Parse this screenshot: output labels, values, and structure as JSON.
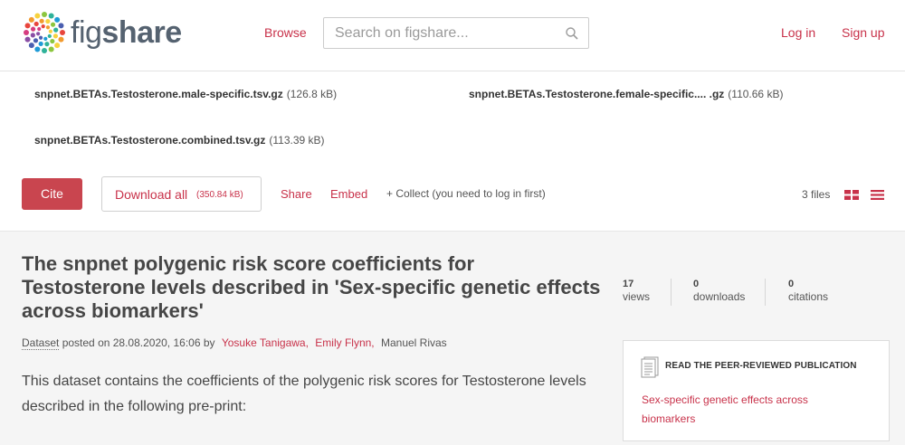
{
  "header": {
    "logo_text_light": "fig",
    "logo_text_bold": "share",
    "browse_label": "Browse",
    "search_placeholder": "Search on figshare...",
    "login_label": "Log in",
    "signup_label": "Sign up"
  },
  "files": [
    {
      "name": "snpnet.BETAs.Testosterone.male-specific.tsv.gz",
      "size": "(126.8 kB)"
    },
    {
      "name": "snpnet.BETAs.Testosterone.female-specific.... .gz",
      "size": "(110.66 kB)"
    },
    {
      "name": "snpnet.BETAs.Testosterone.combined.tsv.gz",
      "size": "(113.39 kB)"
    }
  ],
  "actions": {
    "cite_label": "Cite",
    "download_label": "Download all",
    "download_size": "(350.84 kB)",
    "share_label": "Share",
    "embed_label": "Embed",
    "collect_label": "+ Collect (you need to log in first)",
    "files_count": "3 files"
  },
  "article": {
    "title": "The snpnet polygenic risk score coefficients for Testosterone levels described in 'Sex-specific genetic effects across biomarkers'",
    "type_label": "Dataset",
    "posted_text": "posted on 28.08.2020, 16:06 by",
    "authors": [
      "Yosuke Tanigawa,",
      "Emily Flynn,",
      "Manuel Rivas"
    ],
    "description": "This dataset contains the coefficients of the polygenic risk scores for Testosterone levels described in the following pre-print:"
  },
  "stats": [
    {
      "value": "17",
      "label": "views"
    },
    {
      "value": "0",
      "label": "downloads"
    },
    {
      "value": "0",
      "label": "citations"
    }
  ],
  "publication": {
    "heading": "READ THE PEER-REVIEWED PUBLICATION",
    "link_text": "Sex-specific genetic effects across biomarkers"
  },
  "colors": {
    "accent": "#c8324a",
    "cite_button": "#c9454f",
    "main_background": "#f5f5f5",
    "logo_text": "#556270"
  },
  "icons": {
    "logo": "figshare-logo-icon",
    "search": "search-icon",
    "grid_view": "grid-view-icon",
    "list_view": "list-view-icon",
    "publication": "document-icon"
  }
}
